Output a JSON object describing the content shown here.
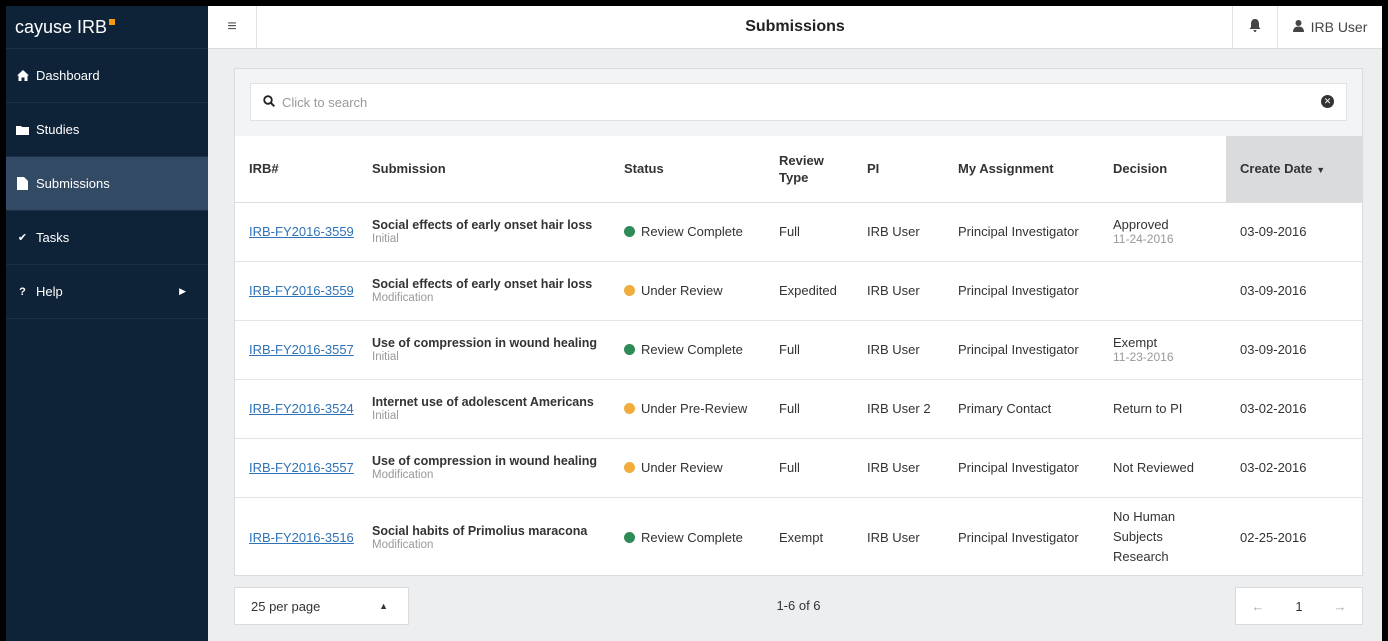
{
  "brand": {
    "name": "cayuse IRB"
  },
  "sidebar": {
    "items": [
      {
        "label": "Dashboard",
        "icon": "home-icon",
        "glyph": "🏠"
      },
      {
        "label": "Studies",
        "icon": "folder-icon",
        "glyph": "▀"
      },
      {
        "label": "Submissions",
        "icon": "file-icon",
        "glyph": "▆"
      },
      {
        "label": "Tasks",
        "icon": "check-icon",
        "glyph": "✔"
      },
      {
        "label": "Help",
        "icon": "question-icon",
        "glyph": "?"
      }
    ],
    "active": "Submissions"
  },
  "header": {
    "title": "Submissions",
    "user_name": "IRB User"
  },
  "search": {
    "placeholder": "Click to search"
  },
  "table": {
    "columns": {
      "irb": "IRB#",
      "submission": "Submission",
      "status": "Status",
      "review_type": "Review Type",
      "pi": "PI",
      "assignment": "My Assignment",
      "decision": "Decision",
      "create_date": "Create Date"
    },
    "sorted_by": "Create Date",
    "rows": [
      {
        "irb": "IRB-FY2016-3559",
        "title": "Social effects of early onset hair loss",
        "type": "Initial",
        "status": "Review Complete",
        "status_color": "#2e8b57",
        "review_type": "Full",
        "pi": "IRB User",
        "assignment": "Principal Investigator",
        "decision": "Approved",
        "decision_date": "11-24-2016",
        "create_date": "03-09-2016"
      },
      {
        "irb": "IRB-FY2016-3559",
        "title": "Social effects of early onset hair loss",
        "type": "Modification",
        "status": "Under Review",
        "status_color": "#f0ad3e",
        "review_type": "Expedited",
        "pi": "IRB User",
        "assignment": "Principal Investigator",
        "decision": "",
        "decision_date": "",
        "create_date": "03-09-2016"
      },
      {
        "irb": "IRB-FY2016-3557",
        "title": "Use of compression in wound healing",
        "type": "Initial",
        "status": "Review Complete",
        "status_color": "#2e8b57",
        "review_type": "Full",
        "pi": "IRB User",
        "assignment": "Principal Investigator",
        "decision": "Exempt",
        "decision_date": "11-23-2016",
        "create_date": "03-09-2016"
      },
      {
        "irb": "IRB-FY2016-3524",
        "title": "Internet use of adolescent Americans",
        "type": "Initial",
        "status": "Under Pre-Review",
        "status_color": "#f0ad3e",
        "review_type": "Full",
        "pi": "IRB User 2",
        "assignment": "Primary Contact",
        "decision": "Return to PI",
        "decision_date": "",
        "create_date": "03-02-2016"
      },
      {
        "irb": "IRB-FY2016-3557",
        "title": "Use of compression in wound healing",
        "type": "Modification",
        "status": "Under Review",
        "status_color": "#f0ad3e",
        "review_type": "Full",
        "pi": "IRB User",
        "assignment": "Principal Investigator",
        "decision": "Not Reviewed",
        "decision_date": "",
        "create_date": "03-02-2016"
      },
      {
        "irb": "IRB-FY2016-3516",
        "title": "Social habits of Primolius maracona",
        "type": "Modification",
        "status": "Review Complete",
        "status_color": "#2e8b57",
        "review_type": "Exempt",
        "pi": "IRB User",
        "assignment": "Principal Investigator",
        "decision": "No Human Subjects Research",
        "decision_date": "",
        "create_date": "02-25-2016"
      }
    ]
  },
  "footer": {
    "per_page": "25 per page",
    "count": "1-6 of 6",
    "page": "1"
  }
}
